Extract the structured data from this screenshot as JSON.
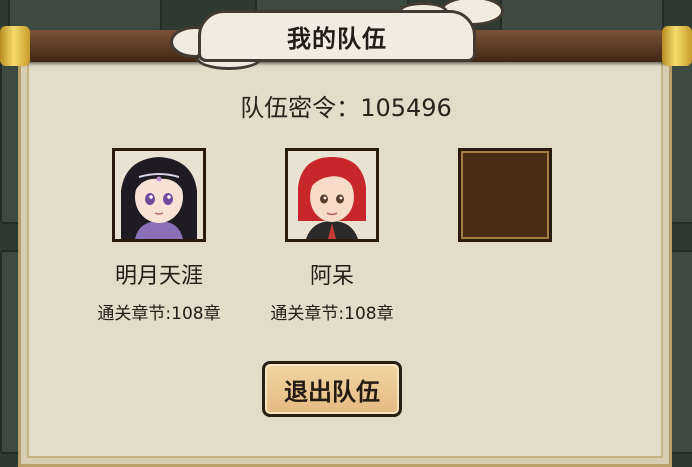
{
  "dialog": {
    "title": "我的队伍",
    "team_code_label": "队伍密令：",
    "team_code_value": "105496",
    "leave_button_label": "退出队伍"
  },
  "members": [
    {
      "name": "明月天涯",
      "progress_label": "通关章节:108章",
      "avatar": "purple-haired-heroine-portrait"
    },
    {
      "name": "阿呆",
      "progress_label": "通关章节:108章",
      "avatar": "red-haired-hero-portrait"
    }
  ],
  "empty_slot": {
    "avatar": "empty-member-slot"
  },
  "colors": {
    "panel_background": "#e3dcc8",
    "slot_background": "#4a2c14",
    "button_fill": "#e4b981",
    "rod_brown": "#5b3a24",
    "rod_gold": "#f6dc6c"
  }
}
